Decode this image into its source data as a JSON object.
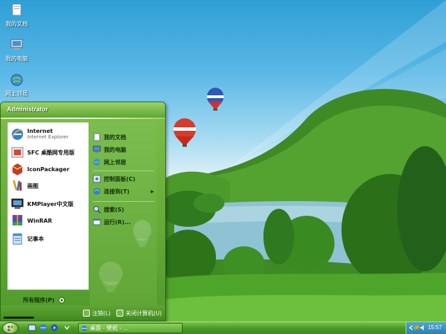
{
  "desktop": {
    "icons": [
      {
        "label": "我的文档",
        "icon": "folder-documents-icon"
      },
      {
        "label": "我的电脑",
        "icon": "computer-icon"
      },
      {
        "label": "网上邻居",
        "icon": "network-icon"
      }
    ]
  },
  "start_menu": {
    "user": "Administrator",
    "pinned": [
      {
        "title": "Internet",
        "subtitle": "Internet Explorer",
        "icon": "internet-explorer-icon"
      },
      {
        "title": "SFC 桌酷网专用版",
        "icon": "sfc-app-icon"
      },
      {
        "title": "IconPackager",
        "icon": "iconpackager-icon"
      },
      {
        "title": "画图",
        "icon": "paint-icon"
      },
      {
        "title": "KMPlayer中文版",
        "icon": "kmplayer-icon"
      },
      {
        "title": "WinRAR",
        "icon": "winrar-icon"
      },
      {
        "title": "记事本",
        "icon": "notepad-icon"
      }
    ],
    "places": [
      {
        "label": "我的文档",
        "icon": "documents-icon"
      },
      {
        "label": "我的电脑",
        "icon": "computer-icon"
      },
      {
        "label": "网上邻居",
        "icon": "network-icon"
      },
      {
        "label": "控制面板(C)",
        "icon": "control-panel-icon"
      },
      {
        "label": "连接到(T)",
        "icon": "connect-icon",
        "submenu": true
      },
      {
        "label": "搜索(S)",
        "icon": "search-icon"
      },
      {
        "label": "运行(R)...",
        "icon": "run-icon"
      }
    ],
    "all_programs": "所有程序(P)",
    "logoff": "注销(L)",
    "shutdown": "关闭计算机(U)"
  },
  "taskbar": {
    "task_label": "桌面 - 壁纸 - ...",
    "clock": "15:57"
  },
  "colors": {
    "menu_green": "#5fa535",
    "taskbar_green": "#4b9a28",
    "tray_blue": "#2f7fb0"
  }
}
